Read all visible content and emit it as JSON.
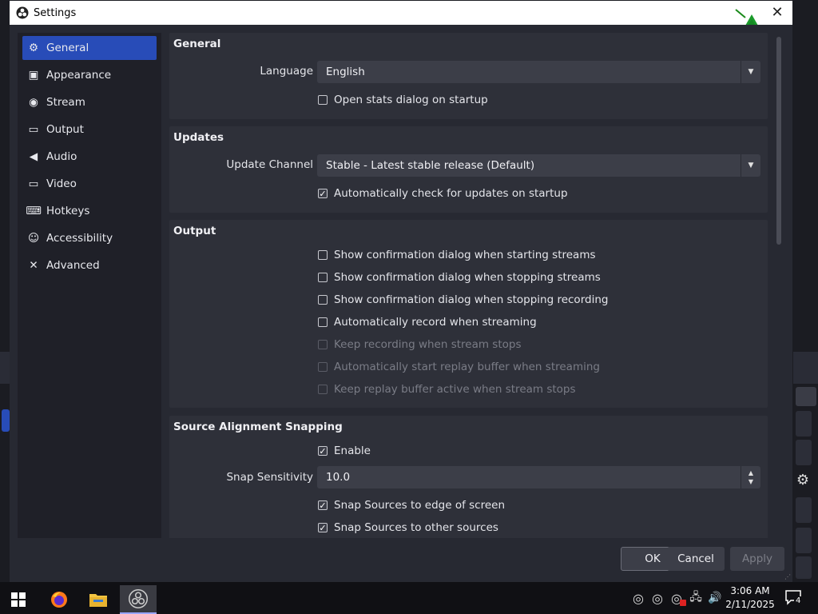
{
  "window": {
    "title": "Settings"
  },
  "sidebar": {
    "items": [
      {
        "label": "General",
        "icon": "gear-icon",
        "active": true
      },
      {
        "label": "Appearance",
        "icon": "appearance-icon"
      },
      {
        "label": "Stream",
        "icon": "broadcast-icon"
      },
      {
        "label": "Output",
        "icon": "output-icon"
      },
      {
        "label": "Audio",
        "icon": "speaker-icon"
      },
      {
        "label": "Video",
        "icon": "monitor-icon"
      },
      {
        "label": "Hotkeys",
        "icon": "keyboard-icon"
      },
      {
        "label": "Accessibility",
        "icon": "accessibility-icon"
      },
      {
        "label": "Advanced",
        "icon": "tools-icon"
      }
    ]
  },
  "general": {
    "title": "General",
    "language_label": "Language",
    "language_value": "English",
    "open_stats_label": "Open stats dialog on startup",
    "open_stats_checked": false
  },
  "updates": {
    "title": "Updates",
    "channel_label": "Update Channel",
    "channel_value": "Stable - Latest stable release (Default)",
    "auto_check_label": "Automatically check for updates on startup",
    "auto_check_checked": true
  },
  "output": {
    "title": "Output",
    "options": [
      {
        "label": "Show confirmation dialog when starting streams",
        "checked": false,
        "disabled": false
      },
      {
        "label": "Show confirmation dialog when stopping streams",
        "checked": false,
        "disabled": false
      },
      {
        "label": "Show confirmation dialog when stopping recording",
        "checked": false,
        "disabled": false
      },
      {
        "label": "Automatically record when streaming",
        "checked": false,
        "disabled": false
      },
      {
        "label": "Keep recording when stream stops",
        "checked": false,
        "disabled": true
      },
      {
        "label": "Automatically start replay buffer when streaming",
        "checked": false,
        "disabled": true
      },
      {
        "label": "Keep replay buffer active when stream stops",
        "checked": false,
        "disabled": true
      }
    ]
  },
  "snapping": {
    "title": "Source Alignment Snapping",
    "enable_label": "Enable",
    "enable_checked": true,
    "sensitivity_label": "Snap Sensitivity",
    "sensitivity_value": "10.0",
    "edge_label": "Snap Sources to edge of screen",
    "edge_checked": true,
    "other_label": "Snap Sources to other sources",
    "other_checked": true
  },
  "buttons": {
    "ok": "OK",
    "cancel": "Cancel",
    "apply": "Apply"
  },
  "taskbar": {
    "time": "3:06 AM",
    "date": "2/11/2025",
    "notification_count": "4"
  },
  "colors": {
    "accent": "#284cb8",
    "dialog_bg": "#272932",
    "group_bg": "#2e3039"
  }
}
